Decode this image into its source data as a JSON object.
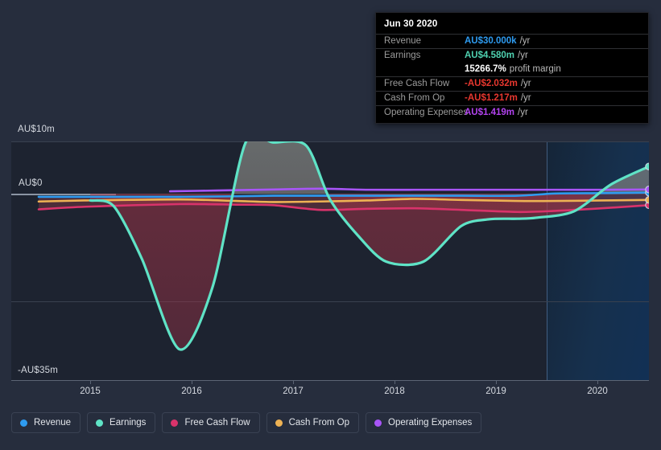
{
  "chart_data": {
    "type": "line",
    "title": "",
    "xlabel": "",
    "ylabel": "",
    "currency": "AU$",
    "ylim": [
      -35,
      10
    ],
    "y_ticks": [
      {
        "value": 10,
        "label": "AU$10m"
      },
      {
        "value": 0,
        "label": "AU$0"
      },
      {
        "value": -35,
        "label": "-AU$35m"
      }
    ],
    "x_ticks": [
      "2015",
      "2016",
      "2017",
      "2018",
      "2019",
      "2020"
    ],
    "grid": true,
    "legend_position": "bottom",
    "forecast_start": "2019.8",
    "series": [
      {
        "name": "Revenue",
        "color": "#2e9bf0",
        "x": [
          2014.5,
          2015,
          2016,
          2016.6,
          2017,
          2017.5,
          2018,
          2018.5,
          2019,
          2019.6,
          2020,
          2020.5,
          2021
        ],
        "values": [
          -0.6,
          -0.6,
          -0.6,
          -0.5,
          -0.4,
          -0.4,
          -0.4,
          -0.4,
          -0.4,
          -0.4,
          0.03,
          0.1,
          0.2
        ]
      },
      {
        "name": "Earnings",
        "color": "#5fe3c6",
        "x": [
          2015.05,
          2015.3,
          2015.6,
          2016,
          2016.35,
          2016.7,
          2017,
          2017.35,
          2017.6,
          2017.9,
          2018.2,
          2018.6,
          2019,
          2019.3,
          2019.6,
          2019.8,
          2020.2,
          2020.6,
          2021
        ],
        "values": [
          -1.3,
          -2.4,
          -12.5,
          -29.8,
          -18.0,
          9.6,
          9.8,
          9.2,
          -1.0,
          -8.0,
          -13.0,
          -13.0,
          -6.2,
          -4.9,
          -4.8,
          -4.6,
          -3.4,
          1.8,
          5.2
        ]
      },
      {
        "name": "Free Cash Flow",
        "color": "#d9336b",
        "x": [
          2014.5,
          2015,
          2016,
          2016.6,
          2017,
          2017.5,
          2018,
          2018.5,
          2019,
          2019.6,
          2020,
          2020.5,
          2021
        ],
        "values": [
          -3.0,
          -2.5,
          -2.0,
          -2.1,
          -2.2,
          -3.1,
          -2.9,
          -2.8,
          -3.1,
          -3.5,
          -3.3,
          -2.8,
          -2.2
        ]
      },
      {
        "name": "Cash From Op",
        "color": "#eeb254",
        "x": [
          2014.5,
          2015,
          2016,
          2016.6,
          2017,
          2017.5,
          2018,
          2018.5,
          2019,
          2019.6,
          2020,
          2020.5,
          2021
        ],
        "values": [
          -1.5,
          -1.3,
          -1.1,
          -1.4,
          -1.6,
          -1.5,
          -1.3,
          -1.0,
          -1.2,
          -1.4,
          -1.4,
          -1.3,
          -1.2
        ]
      },
      {
        "name": "Operating Expenses",
        "color": "#a855f7",
        "x": [
          2015.9,
          2016.4,
          2017,
          2017.5,
          2018,
          2018.5,
          2019,
          2019.6,
          2020,
          2020.5,
          2021
        ],
        "values": [
          0.45,
          0.6,
          0.8,
          0.95,
          0.75,
          0.75,
          0.75,
          0.75,
          0.75,
          0.75,
          0.8
        ]
      }
    ]
  },
  "tooltip": {
    "date": "Jun 30 2020",
    "rows": [
      {
        "key": "Revenue",
        "value": "AU$30.000k",
        "unit": "/yr",
        "color": "#2e9bf0"
      },
      {
        "key": "Earnings",
        "value": "AU$4.580m",
        "unit": "/yr",
        "color": "#4fd1b0"
      },
      {
        "key": "",
        "value": "15266.7%",
        "unit": "profit margin",
        "color": "#ffffff"
      },
      {
        "key": "Free Cash Flow",
        "value": "-AU$2.032m",
        "unit": "/yr",
        "color": "#e8372f"
      },
      {
        "key": "Cash From Op",
        "value": "-AU$1.217m",
        "unit": "/yr",
        "color": "#e8372f"
      },
      {
        "key": "Operating Expenses",
        "value": "AU$1.419m",
        "unit": "/yr",
        "color": "#b243ef"
      }
    ]
  },
  "legend": {
    "items": [
      {
        "label": "Revenue",
        "color": "#2e9bf0"
      },
      {
        "label": "Earnings",
        "color": "#5fe3c6"
      },
      {
        "label": "Free Cash Flow",
        "color": "#d9336b"
      },
      {
        "label": "Cash From Op",
        "color": "#eeb254"
      },
      {
        "label": "Operating Expenses",
        "color": "#a855f7"
      }
    ]
  },
  "axis": {
    "y_top": "AU$10m",
    "y_zero": "AU$0",
    "y_bottom": "-AU$35m",
    "x": [
      "2015",
      "2016",
      "2017",
      "2018",
      "2019",
      "2020"
    ]
  }
}
